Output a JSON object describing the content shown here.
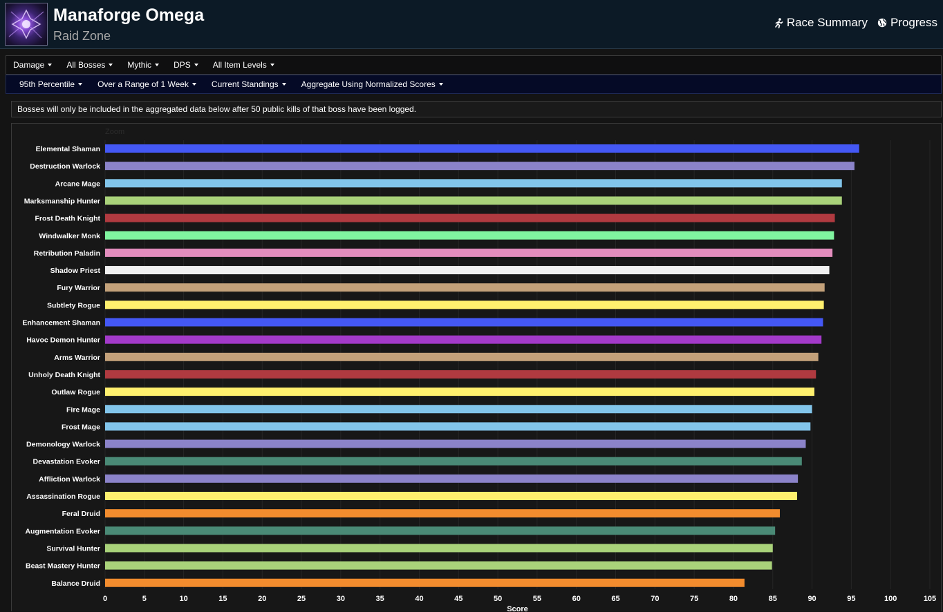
{
  "header": {
    "title": "Manaforge Omega",
    "subtitle": "Raid Zone",
    "links": [
      {
        "label": "Race Summary",
        "icon": "runner-icon"
      },
      {
        "label": "Progress",
        "icon": "globe-icon"
      }
    ]
  },
  "filters_primary": [
    "Damage",
    "All Bosses",
    "Mythic",
    "DPS",
    "All Item Levels"
  ],
  "filters_secondary": [
    "95th Percentile",
    "Over a Range of 1 Week",
    "Current Standings",
    "Aggregate Using Normalized Scores"
  ],
  "notice": "Bosses will only be included in the aggregated data below after 50 public kills of that boss have been logged.",
  "chart": {
    "zoom_label": "Zoom"
  },
  "chart_data": {
    "type": "bar",
    "orientation": "horizontal",
    "xlabel": "Score",
    "xlim": [
      0,
      105
    ],
    "xticks": [
      0,
      5,
      10,
      15,
      20,
      25,
      30,
      35,
      40,
      45,
      50,
      55,
      60,
      65,
      70,
      75,
      80,
      85,
      90,
      95,
      100,
      105
    ],
    "grid": true,
    "categories": [
      "Elemental Shaman",
      "Destruction Warlock",
      "Arcane Mage",
      "Marksmanship Hunter",
      "Frost Death Knight",
      "Windwalker Monk",
      "Retribution Paladin",
      "Shadow Priest",
      "Fury Warrior",
      "Subtlety Rogue",
      "Enhancement Shaman",
      "Havoc Demon Hunter",
      "Arms Warrior",
      "Unholy Death Knight",
      "Outlaw Rogue",
      "Fire Mage",
      "Frost Mage",
      "Demonology Warlock",
      "Devastation Evoker",
      "Affliction Warlock",
      "Assassination Rogue",
      "Feral Druid",
      "Augmentation Evoker",
      "Survival Hunter",
      "Beast Mastery Hunter",
      "Balance Druid"
    ],
    "values": [
      96.0,
      95.4,
      93.8,
      93.8,
      92.9,
      92.8,
      92.6,
      92.2,
      91.6,
      91.5,
      91.4,
      91.2,
      90.8,
      90.5,
      90.3,
      90.0,
      89.8,
      89.2,
      88.7,
      88.2,
      88.1,
      85.9,
      85.3,
      85.0,
      84.9,
      81.4
    ],
    "colors": [
      "#4458f5",
      "#8b83c9",
      "#82c5ea",
      "#a9d27a",
      "#b03a40",
      "#80f5a0",
      "#e38dbd",
      "#f0f0f0",
      "#c3a17a",
      "#fff06e",
      "#4458f5",
      "#a33ac9",
      "#c3a17a",
      "#b03a40",
      "#fff06e",
      "#82c5ea",
      "#82c5ea",
      "#8b83c9",
      "#4a8a76",
      "#8b83c9",
      "#fff06e",
      "#f28c2e",
      "#4a8a76",
      "#a9d27a",
      "#a9d27a",
      "#f28c2e"
    ]
  }
}
